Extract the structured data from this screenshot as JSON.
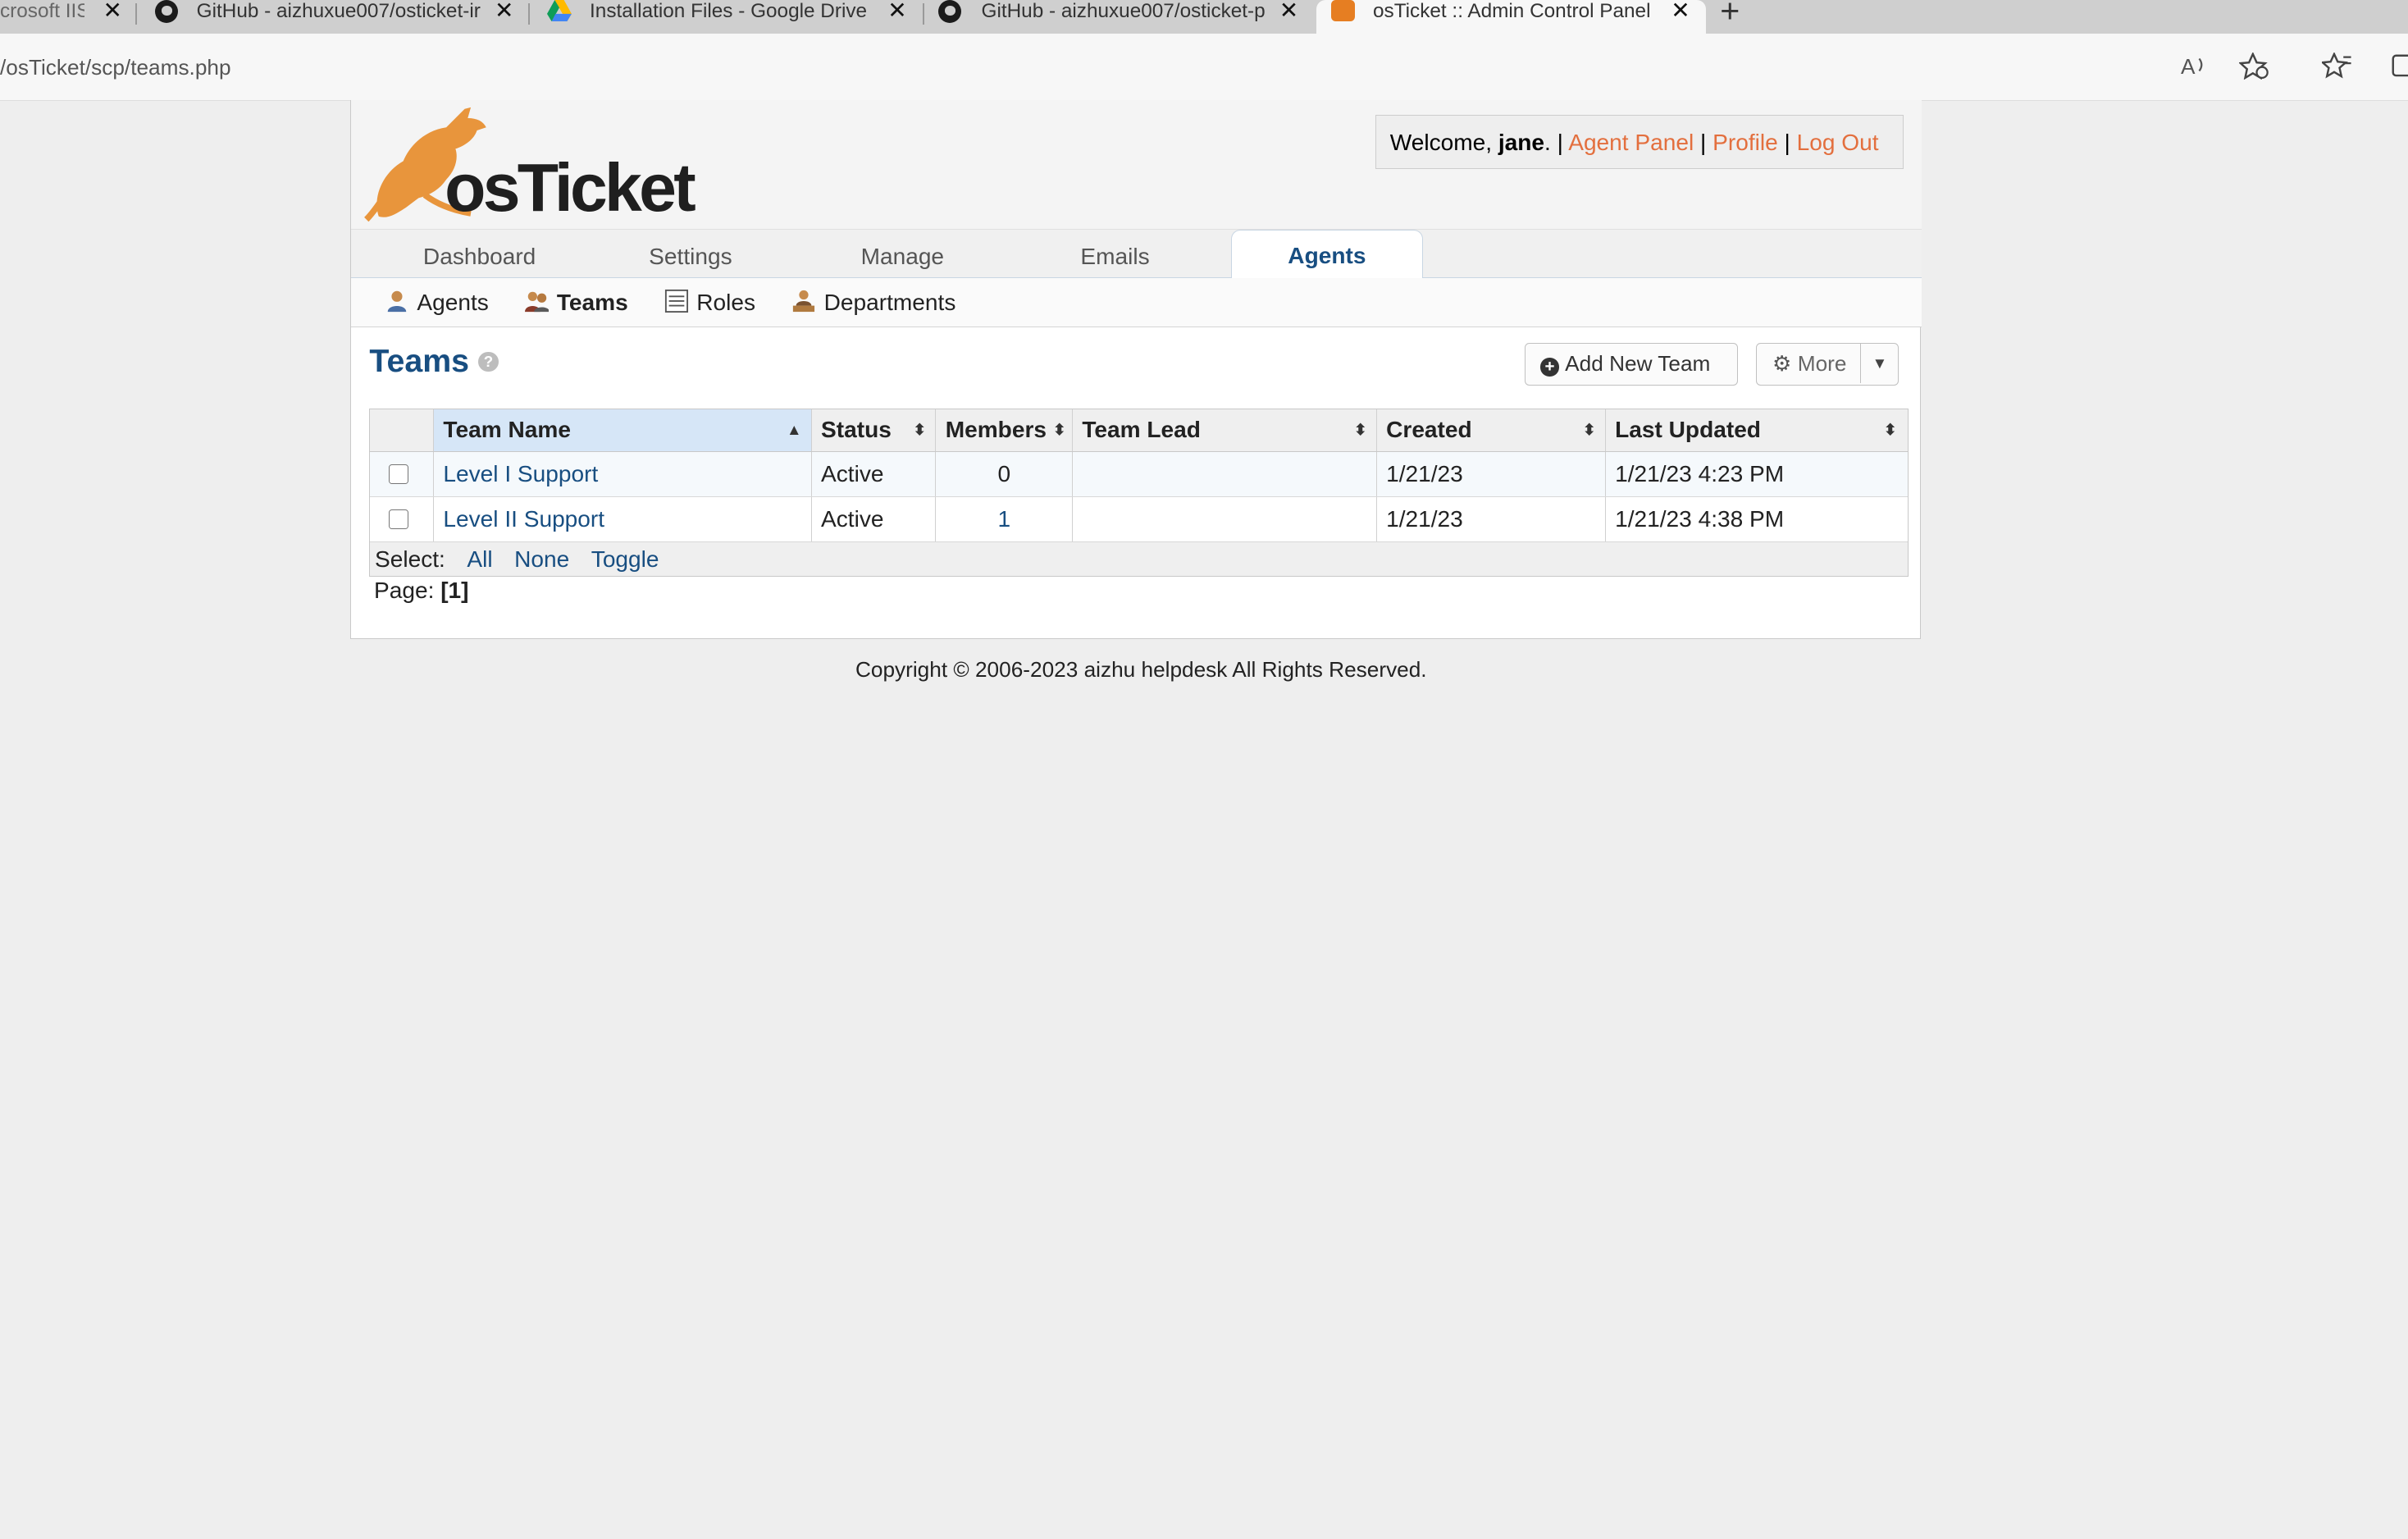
{
  "browser": {
    "tabs": [
      {
        "title": "crosoft IIS",
        "icon": "windows-icon"
      },
      {
        "title": "GitHub - aizhuxue007/osticket-ir",
        "icon": "github-icon"
      },
      {
        "title": "Installation Files - Google Drive",
        "icon": "google-drive-icon"
      },
      {
        "title": "GitHub - aizhuxue007/osticket-p",
        "icon": "github-icon"
      },
      {
        "title": "osTicket :: Admin Control Panel",
        "icon": "osticket-icon",
        "active": true
      }
    ],
    "new_tab": "+",
    "close_glyph": "✕",
    "url": "/osTicket/scp/teams.php",
    "toolbar_icons": [
      "read-aloud-icon",
      "add-favorite-icon",
      "favorites-icon",
      "collections-icon"
    ]
  },
  "header": {
    "logo_text": "osTicket",
    "welcome_prefix": "Welcome, ",
    "username": "jane",
    "welcome_suffix": ".",
    "sep": "|",
    "links": {
      "agent_panel": "Agent Panel",
      "profile": "Profile",
      "logout": "Log Out"
    }
  },
  "nav": {
    "tabs": [
      {
        "label": "Dashboard"
      },
      {
        "label": "Settings"
      },
      {
        "label": "Manage"
      },
      {
        "label": "Emails"
      },
      {
        "label": "Agents",
        "active": true
      }
    ]
  },
  "subnav": {
    "items": [
      {
        "label": "Agents",
        "icon": "agent-icon"
      },
      {
        "label": "Teams",
        "icon": "teams-icon",
        "active": true
      },
      {
        "label": "Roles",
        "icon": "roles-icon"
      },
      {
        "label": "Departments",
        "icon": "departments-icon"
      }
    ]
  },
  "page": {
    "title": "Teams",
    "help": "?",
    "add_button": "Add New Team",
    "more_button": "More"
  },
  "table": {
    "columns": [
      "Team Name",
      "Status",
      "Members",
      "Team Lead",
      "Created",
      "Last Updated"
    ],
    "rows": [
      {
        "name": "Level I Support",
        "status": "Active",
        "members": "0",
        "lead": "",
        "created": "1/21/23",
        "updated": "1/21/23 4:23 PM"
      },
      {
        "name": "Level II Support",
        "status": "Active",
        "members": "1",
        "lead": "",
        "created": "1/21/23",
        "updated": "1/21/23 4:38 PM"
      }
    ],
    "select_label": "Select:",
    "select_all": "All",
    "select_none": "None",
    "select_toggle": "Toggle"
  },
  "pager": {
    "label": "Page:",
    "current": "[1]"
  },
  "footer": {
    "copyright": "Copyright © 2006-2023 aizhu helpdesk All Rights Reserved."
  },
  "colors": {
    "brand_orange": "#e36f3e",
    "link_blue": "#184e81",
    "logo_orange": "#e8953c"
  }
}
